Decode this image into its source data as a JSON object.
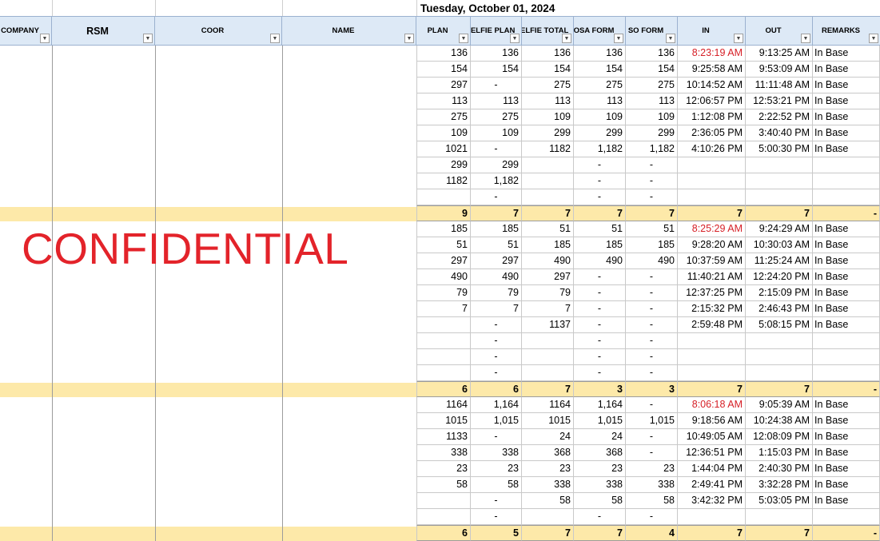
{
  "date_title": "Tuesday, October 01, 2024",
  "confidential_text": "CONFIDENTIAL",
  "headers": {
    "company": "COMPANY",
    "rsm": "RSM",
    "coor": "COOR",
    "name": "NAME",
    "plan": "PLAN",
    "selfie_plan": "SELFIE PLAN",
    "selfie_total": "SELFIE TOTAL",
    "osa_form": "OSA FORM",
    "so_form": "SO FORM",
    "in": "IN",
    "out": "OUT",
    "remarks": "REMARKS"
  },
  "filter_icon": "filter-dropdown-icon",
  "colors": {
    "header_bg": "#dde9f6",
    "total_bg": "#fde9a9",
    "late_red": "#d61f26",
    "confidential_red": "#e3232a"
  },
  "rows": [
    {
      "type": "data",
      "plan": "136",
      "selfie_plan": "136",
      "selfie_total": "136",
      "osa": "136",
      "so": "136",
      "in": "8:23:19 AM",
      "in_late": true,
      "out": "9:13:25 AM",
      "remarks": "In Base"
    },
    {
      "type": "data",
      "plan": "154",
      "selfie_plan": "154",
      "selfie_total": "154",
      "osa": "154",
      "so": "154",
      "in": "9:25:58 AM",
      "in_late": false,
      "out": "9:53:09 AM",
      "remarks": "In Base"
    },
    {
      "type": "data",
      "plan": "297",
      "selfie_plan": "-",
      "selfie_total": "275",
      "osa": "275",
      "so": "275",
      "in": "10:14:52 AM",
      "in_late": false,
      "out": "11:11:48 AM",
      "remarks": "In Base"
    },
    {
      "type": "data",
      "plan": "113",
      "selfie_plan": "113",
      "selfie_total": "113",
      "osa": "113",
      "so": "113",
      "in": "12:06:57 PM",
      "in_late": false,
      "out": "12:53:21 PM",
      "remarks": "In Base"
    },
    {
      "type": "data",
      "plan": "275",
      "selfie_plan": "275",
      "selfie_total": "109",
      "osa": "109",
      "so": "109",
      "in": "1:12:08 PM",
      "in_late": false,
      "out": "2:22:52 PM",
      "remarks": "In Base"
    },
    {
      "type": "data",
      "plan": "109",
      "selfie_plan": "109",
      "selfie_total": "299",
      "osa": "299",
      "so": "299",
      "in": "2:36:05 PM",
      "in_late": false,
      "out": "3:40:40 PM",
      "remarks": "In Base"
    },
    {
      "type": "data",
      "plan": "1021",
      "selfie_plan": "-",
      "selfie_total": "1182",
      "osa": "1,182",
      "so": "1,182",
      "in": "4:10:26 PM",
      "in_late": false,
      "out": "5:00:30 PM",
      "remarks": "In Base"
    },
    {
      "type": "data",
      "plan": "299",
      "selfie_plan": "299",
      "selfie_total": "",
      "osa": "-",
      "so": "-",
      "in": "",
      "in_late": false,
      "out": "",
      "remarks": ""
    },
    {
      "type": "data",
      "plan": "1182",
      "selfie_plan": "1,182",
      "selfie_total": "",
      "osa": "-",
      "so": "-",
      "in": "",
      "in_late": false,
      "out": "",
      "remarks": ""
    },
    {
      "type": "data",
      "plan": "",
      "selfie_plan": "-",
      "selfie_total": "",
      "osa": "-",
      "so": "-",
      "in": "",
      "in_late": false,
      "out": "",
      "remarks": ""
    },
    {
      "type": "total",
      "plan": "9",
      "selfie_plan": "7",
      "selfie_total": "7",
      "osa": "7",
      "so": "7",
      "in": "7",
      "in_late": false,
      "out": "7",
      "remarks": "-"
    },
    {
      "type": "data",
      "plan": "185",
      "selfie_plan": "185",
      "selfie_total": "51",
      "osa": "51",
      "so": "51",
      "in": "8:25:29 AM",
      "in_late": true,
      "out": "9:24:29 AM",
      "remarks": "In Base"
    },
    {
      "type": "data",
      "plan": "51",
      "selfie_plan": "51",
      "selfie_total": "185",
      "osa": "185",
      "so": "185",
      "in": "9:28:20 AM",
      "in_late": false,
      "out": "10:30:03 AM",
      "remarks": "In Base"
    },
    {
      "type": "data",
      "plan": "297",
      "selfie_plan": "297",
      "selfie_total": "490",
      "osa": "490",
      "so": "490",
      "in": "10:37:59 AM",
      "in_late": false,
      "out": "11:25:24 AM",
      "remarks": "In Base"
    },
    {
      "type": "data",
      "plan": "490",
      "selfie_plan": "490",
      "selfie_total": "297",
      "osa": "-",
      "so": "-",
      "in": "11:40:21 AM",
      "in_late": false,
      "out": "12:24:20 PM",
      "remarks": "In Base"
    },
    {
      "type": "data",
      "plan": "79",
      "selfie_plan": "79",
      "selfie_total": "79",
      "osa": "-",
      "so": "-",
      "in": "12:37:25 PM",
      "in_late": false,
      "out": "2:15:09 PM",
      "remarks": "In Base"
    },
    {
      "type": "data",
      "plan": "7",
      "selfie_plan": "7",
      "selfie_total": "7",
      "osa": "-",
      "so": "-",
      "in": "2:15:32 PM",
      "in_late": false,
      "out": "2:46:43 PM",
      "remarks": "In Base"
    },
    {
      "type": "data",
      "plan": "",
      "selfie_plan": "-",
      "selfie_total": "1137",
      "osa": "-",
      "so": "-",
      "in": "2:59:48 PM",
      "in_late": false,
      "out": "5:08:15 PM",
      "remarks": "In Base"
    },
    {
      "type": "data",
      "plan": "",
      "selfie_plan": "-",
      "selfie_total": "",
      "osa": "-",
      "so": "-",
      "in": "",
      "in_late": false,
      "out": "",
      "remarks": ""
    },
    {
      "type": "data",
      "plan": "",
      "selfie_plan": "-",
      "selfie_total": "",
      "osa": "-",
      "so": "-",
      "in": "",
      "in_late": false,
      "out": "",
      "remarks": ""
    },
    {
      "type": "data",
      "plan": "",
      "selfie_plan": "-",
      "selfie_total": "",
      "osa": "-",
      "so": "-",
      "in": "",
      "in_late": false,
      "out": "",
      "remarks": ""
    },
    {
      "type": "total",
      "plan": "6",
      "selfie_plan": "6",
      "selfie_total": "7",
      "osa": "3",
      "so": "3",
      "in": "7",
      "in_late": false,
      "out": "7",
      "remarks": "-"
    },
    {
      "type": "data",
      "plan": "1164",
      "selfie_plan": "1,164",
      "selfie_total": "1164",
      "osa": "1,164",
      "so": "-",
      "in": "8:06:18 AM",
      "in_late": true,
      "out": "9:05:39 AM",
      "remarks": "In Base"
    },
    {
      "type": "data",
      "plan": "1015",
      "selfie_plan": "1,015",
      "selfie_total": "1015",
      "osa": "1,015",
      "so": "1,015",
      "in": "9:18:56 AM",
      "in_late": false,
      "out": "10:24:38 AM",
      "remarks": "In Base"
    },
    {
      "type": "data",
      "plan": "1133",
      "selfie_plan": "-",
      "selfie_total": "24",
      "osa": "24",
      "so": "-",
      "in": "10:49:05 AM",
      "in_late": false,
      "out": "12:08:09 PM",
      "remarks": "In Base"
    },
    {
      "type": "data",
      "plan": "338",
      "selfie_plan": "338",
      "selfie_total": "368",
      "osa": "368",
      "so": "-",
      "in": "12:36:51 PM",
      "in_late": false,
      "out": "1:15:03 PM",
      "remarks": "In Base"
    },
    {
      "type": "data",
      "plan": "23",
      "selfie_plan": "23",
      "selfie_total": "23",
      "osa": "23",
      "so": "23",
      "in": "1:44:04 PM",
      "in_late": false,
      "out": "2:40:30 PM",
      "remarks": "In Base"
    },
    {
      "type": "data",
      "plan": "58",
      "selfie_plan": "58",
      "selfie_total": "338",
      "osa": "338",
      "so": "338",
      "in": "2:49:41 PM",
      "in_late": false,
      "out": "3:32:28 PM",
      "remarks": "In Base"
    },
    {
      "type": "data",
      "plan": "",
      "selfie_plan": "-",
      "selfie_total": "58",
      "osa": "58",
      "so": "58",
      "in": "3:42:32 PM",
      "in_late": false,
      "out": "5:03:05 PM",
      "remarks": "In Base"
    },
    {
      "type": "data",
      "plan": "",
      "selfie_plan": "-",
      "selfie_total": "",
      "osa": "-",
      "so": "-",
      "in": "",
      "in_late": false,
      "out": "",
      "remarks": ""
    },
    {
      "type": "total",
      "plan": "6",
      "selfie_plan": "5",
      "selfie_total": "7",
      "osa": "7",
      "so": "4",
      "in": "7",
      "in_late": false,
      "out": "7",
      "remarks": "-"
    }
  ]
}
